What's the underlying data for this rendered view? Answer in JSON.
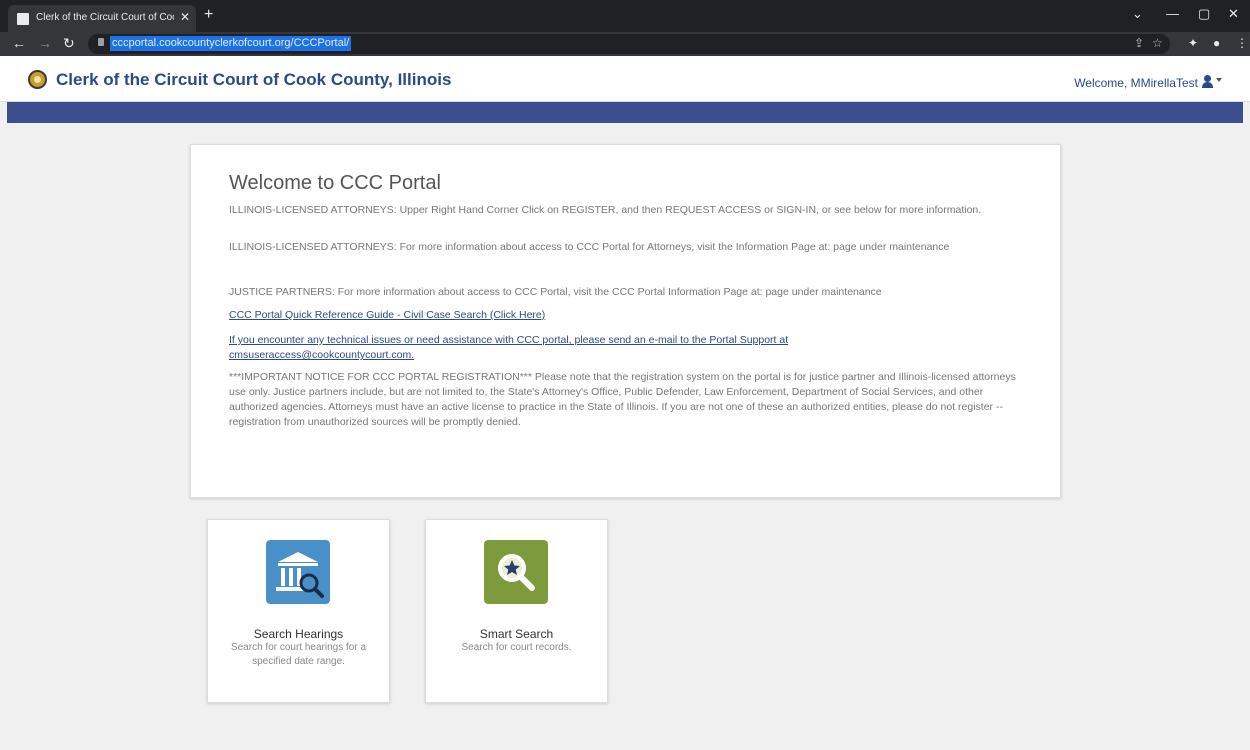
{
  "browser": {
    "tab_title": "Clerk of the Circuit Court of Cook County, Illinois",
    "url": "cccportal.cookcountyclerkofcourt.org/CCCPortal/"
  },
  "header": {
    "site_title": "Clerk of the Circuit Court of Cook County, Illinois",
    "welcome_text": "Welcome, MMirellaTest"
  },
  "welcome": {
    "title": "Welcome to CCC Portal",
    "p1": "ILLINOIS-LICENSED ATTORNEYS: Upper Right Hand Corner Click on REGISTER, and then REQUEST ACCESS or SIGN-IN, or see below for more information.",
    "p2": "ILLINOIS-LICENSED ATTORNEYS: For more information about access to CCC Portal for Attorneys, visit the Information Page at: page under maintenance",
    "p3": "JUSTICE PARTNERS: For more information about access to CCC Portal, visit the CCC Portal Information Page at: page under maintenance",
    "guide_link": "CCC Portal Quick Reference Guide - Civil Case Search (Click Here)",
    "support_text": "If you encounter any technical issues or need assistance with CCC portal, please send an e-mail to the Portal Support at",
    "support_email": "cmsuseraccess@cookcountycourt.com.",
    "notice": "***IMPORTANT NOTICE FOR CCC PORTAL REGISTRATION*** Please note that the registration system on the portal is for justice partner and Illinois-licensed attorneys use only. Justice partners include, but are not limited to, the State's Attorney's Office, Public Defender, Law Enforcement, Department of Social Services, and other authorized agencies. Attorneys must have an active license to practice in the State of Illinois. If you are not one of these an authorized entities, please do not register -- registration from unauthorized sources will be promptly denied."
  },
  "tiles": [
    {
      "title": "Search Hearings",
      "description": "Search for court hearings for a specified date range.",
      "icon": "courthouse-search-icon",
      "color": "#4a90c8"
    },
    {
      "title": "Smart Search",
      "description": "Search for court records.",
      "icon": "magnifier-star-icon",
      "color": "#7d9a3c"
    }
  ]
}
